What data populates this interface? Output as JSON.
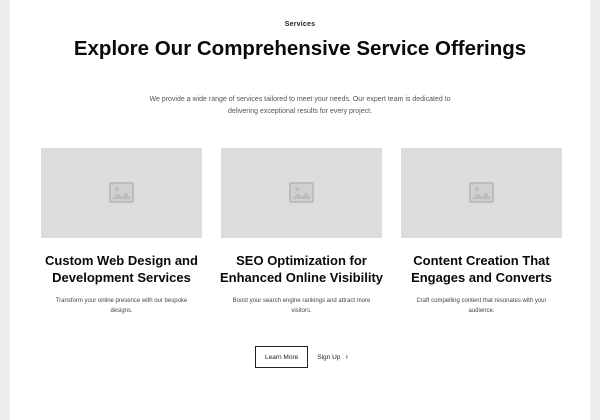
{
  "header": {
    "tagline": "Services",
    "title": "Explore Our Comprehensive Service Offerings",
    "intro": "We provide a wide range of services tailored to meet your needs. Our expert team is dedicated to delivering exceptional results for every project."
  },
  "cards": [
    {
      "image_icon": "image-placeholder-icon",
      "title": "Custom Web Design and Development Services",
      "description": "Transform your online presence with our bespoke designs."
    },
    {
      "image_icon": "image-placeholder-icon",
      "title": "SEO Optimization for Enhanced Online Visibility",
      "description": "Boost your search engine rankings and attract more visitors."
    },
    {
      "image_icon": "image-placeholder-icon",
      "title": "Content Creation That Engages and Converts",
      "description": "Craft compelling content that resonates with your audience."
    }
  ],
  "actions": {
    "primary_label": "Learn More",
    "secondary_label": "Sign Up",
    "secondary_icon": "chevron-right-icon"
  },
  "colors": {
    "page_background": "#ffffff",
    "outer_background": "#eeeeee",
    "placeholder": "#dcdcdc",
    "text": "#111111"
  }
}
